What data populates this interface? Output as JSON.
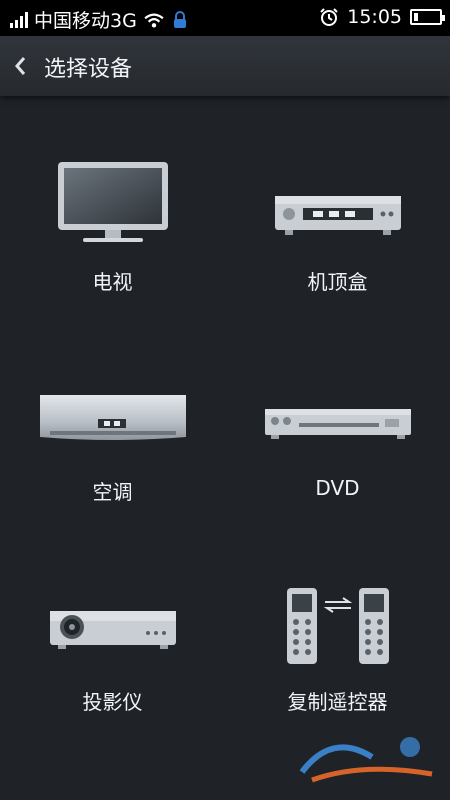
{
  "status_bar": {
    "carrier": "中国移动3G",
    "time": "15:05",
    "battery_fraction": 0.18
  },
  "header": {
    "title": "选择设备"
  },
  "devices": [
    {
      "label": "电视",
      "icon": "tv-icon"
    },
    {
      "label": "机顶盒",
      "icon": "set-top-box-icon"
    },
    {
      "label": "空调",
      "icon": "air-conditioner-icon"
    },
    {
      "label": "DVD",
      "icon": "dvd-player-icon"
    },
    {
      "label": "投影仪",
      "icon": "projector-icon"
    },
    {
      "label": "复制遥控器",
      "icon": "copy-remote-icon"
    }
  ],
  "colors": {
    "background": "#1f2328",
    "header": "#2b3035",
    "device_silver": "#c9ced4"
  }
}
